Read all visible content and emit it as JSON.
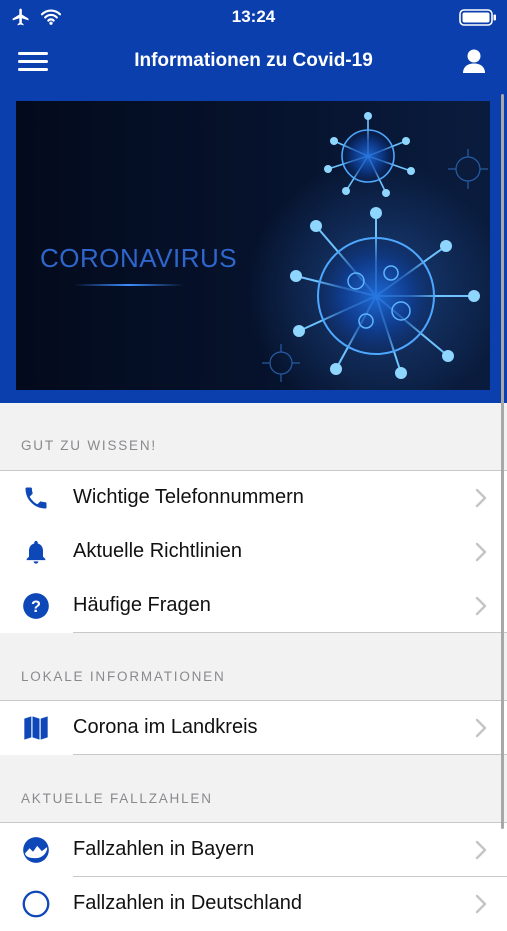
{
  "status_bar": {
    "time": "13:24"
  },
  "nav": {
    "title": "Informationen zu Covid-19"
  },
  "hero": {
    "text": "CORONAVIRUS"
  },
  "sections": [
    {
      "header": "GUT ZU WISSEN!",
      "items": [
        {
          "label": "Wichtige Telefonnummern",
          "icon": "phone-icon"
        },
        {
          "label": "Aktuelle Richtlinien",
          "icon": "bell-icon"
        },
        {
          "label": "Häufige Fragen",
          "icon": "question-icon"
        }
      ]
    },
    {
      "header": "LOKALE INFORMATIONEN",
      "items": [
        {
          "label": "Corona im Landkreis",
          "icon": "map-icon"
        }
      ]
    },
    {
      "header": "AKTUELLE FALLZAHLEN",
      "items": [
        {
          "label": "Fallzahlen in Bayern",
          "icon": "bavaria-icon"
        },
        {
          "label": "Fallzahlen in Deutschland",
          "icon": "germany-icon"
        }
      ]
    }
  ],
  "colors": {
    "brand": "#0b3fad",
    "accent": "#0d47b8"
  }
}
